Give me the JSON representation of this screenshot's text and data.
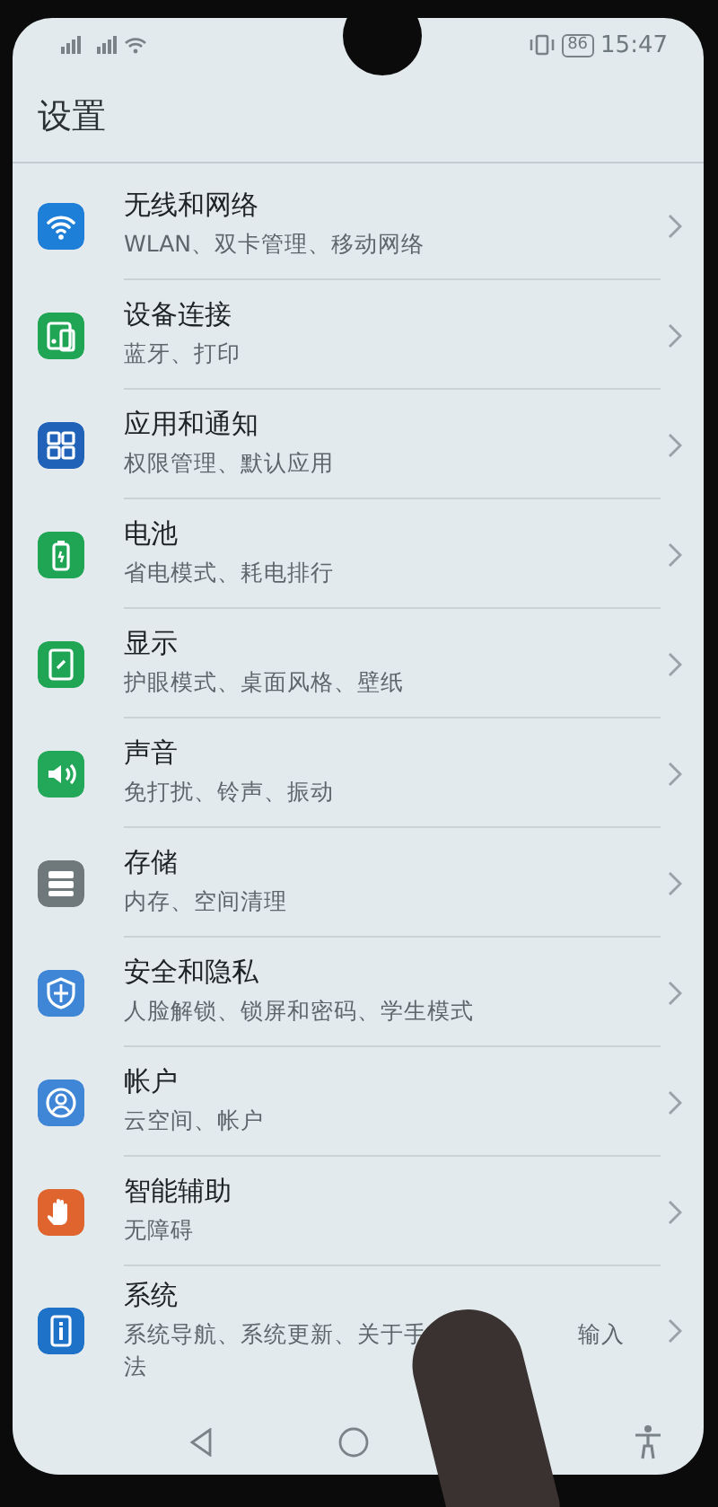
{
  "status_bar": {
    "battery": "86",
    "time": "15:47"
  },
  "title": "设置",
  "items": [
    {
      "title": "无线和网络",
      "subtitle": "WLAN、双卡管理、移动网络",
      "color": "#1e7fd8"
    },
    {
      "title": "设备连接",
      "subtitle": "蓝牙、打印",
      "color": "#1fa554"
    },
    {
      "title": "应用和通知",
      "subtitle": "权限管理、默认应用",
      "color": "#1f62b8"
    },
    {
      "title": "电池",
      "subtitle": "省电模式、耗电排行",
      "color": "#1fa554"
    },
    {
      "title": "显示",
      "subtitle": "护眼模式、桌面风格、壁纸",
      "color": "#1fa554"
    },
    {
      "title": "声音",
      "subtitle": "免打扰、铃声、振动",
      "color": "#23a85a"
    },
    {
      "title": "存储",
      "subtitle": "内存、空间清理",
      "color": "#6f787b"
    },
    {
      "title": "安全和隐私",
      "subtitle": "人脸解锁、锁屏和密码、学生模式",
      "color": "#3f86d6"
    },
    {
      "title": "帐户",
      "subtitle": "云空间、帐户",
      "color": "#3f86d6"
    },
    {
      "title": "智能辅助",
      "subtitle": "无障碍",
      "color": "#e0642e"
    },
    {
      "title": "系统",
      "subtitle_parts": [
        "系统导航、系统更新、关于手",
        "输入",
        "法"
      ],
      "color": "#1e72c8"
    }
  ]
}
